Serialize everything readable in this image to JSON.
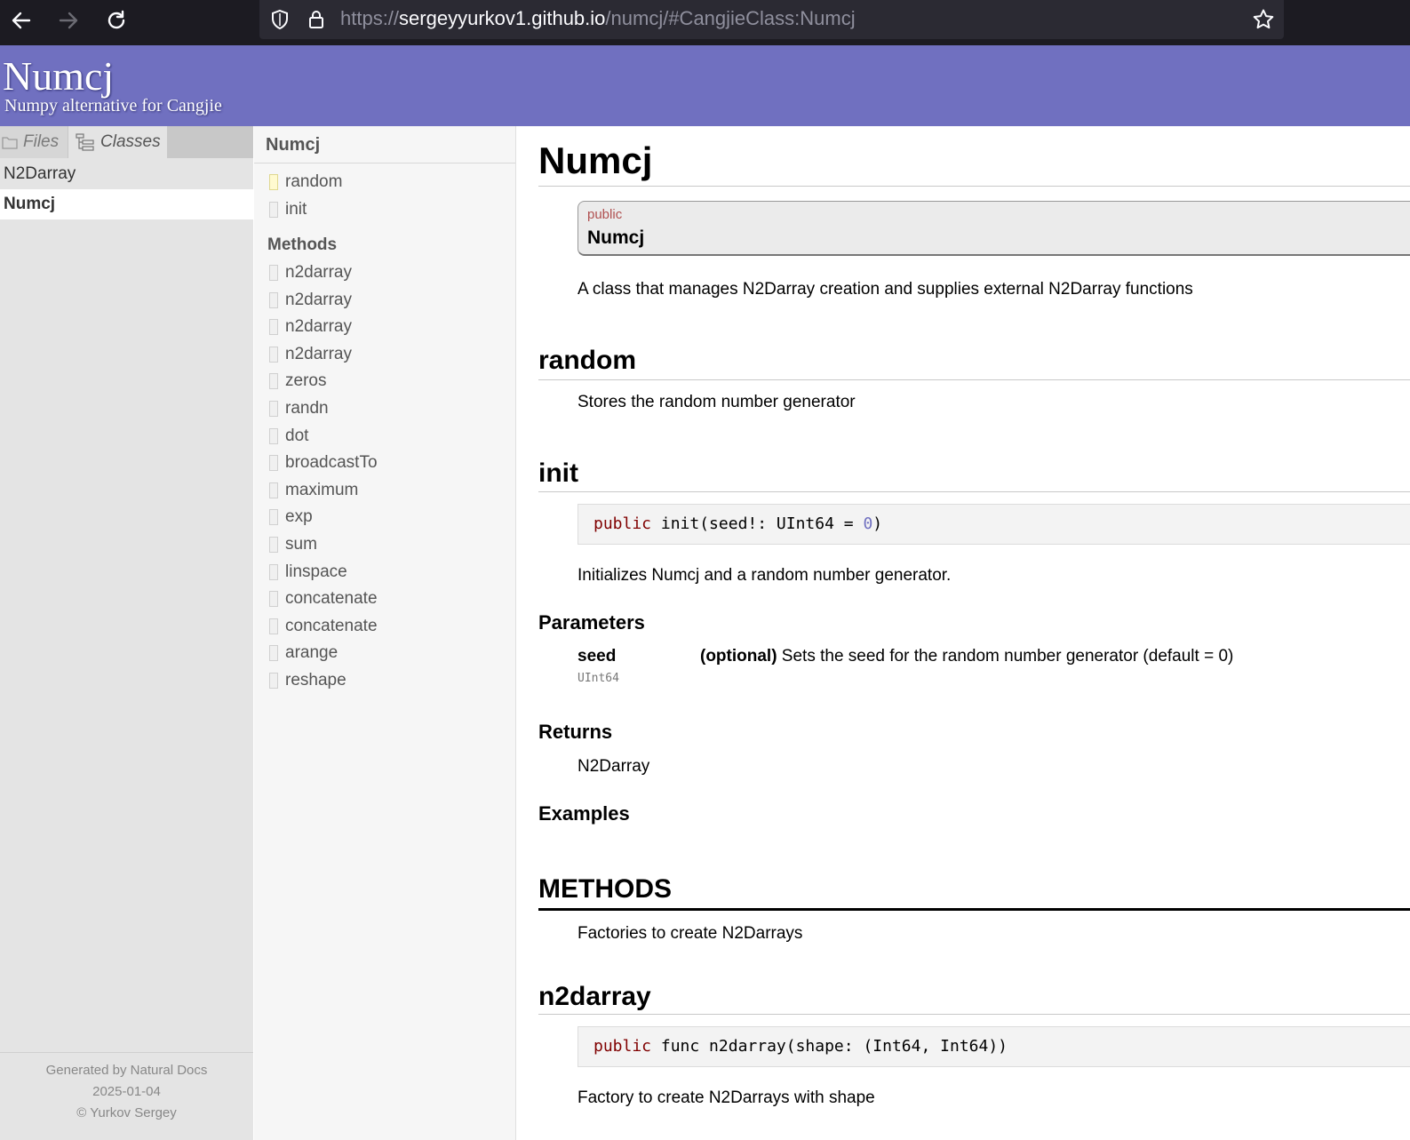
{
  "browser": {
    "url_prefix": "https://",
    "url_host": "sergeyyurkov1.github.io",
    "url_path": "/numcj/#CangjieClass:Numcj"
  },
  "header": {
    "title": "Numcj",
    "subtitle": "Numpy alternative for Cangjie"
  },
  "menu": {
    "tabs": [
      "Files",
      "Classes"
    ],
    "entries": [
      "N2Darray",
      "Numcj"
    ],
    "footer": [
      "Generated by Natural Docs",
      "2025-01-04",
      "© Yurkov Sergey"
    ]
  },
  "summary": {
    "title": "Numcj",
    "variables": [
      "random",
      "init"
    ],
    "methods_heading": "Methods",
    "methods": [
      "n2darray",
      "n2darray",
      "n2darray",
      "n2darray",
      "zeros",
      "randn",
      "dot",
      "broadcastTo",
      "maximum",
      "exp",
      "sum",
      "linspace",
      "concatenate",
      "concatenate",
      "arange",
      "reshape"
    ]
  },
  "content": {
    "class_title": "Numcj",
    "class_modifier": "public",
    "class_name": "Numcj",
    "class_description": "A class that manages N2Darray creation and supplies external N2Darray functions",
    "random_title": "random",
    "random_description": "Stores the random number generator",
    "init_title": "init",
    "init_code": {
      "keyword": "public",
      "before_num": " init(seed!: UInt64 = ",
      "num": "0",
      "after_num": ")"
    },
    "init_description": "Initializes Numcj and a random number generator.",
    "parameters_heading": "Parameters",
    "param_name": "seed",
    "param_type": "UInt64",
    "param_optional": "(optional)",
    "param_desc": " Sets the seed for the random number generator (default = 0)",
    "returns_heading": "Returns",
    "returns_value": "N2Darray",
    "examples_heading": "Examples",
    "methods_title": "METHODS",
    "methods_description": "Factories to create N2Darrays",
    "n2darray_title": "n2darray",
    "n2darray_code": {
      "keyword": "public",
      "rest": " func n2darray(shape: (Int64, Int64))"
    },
    "n2darray_description": "Factory to create N2Darrays with shape"
  }
}
